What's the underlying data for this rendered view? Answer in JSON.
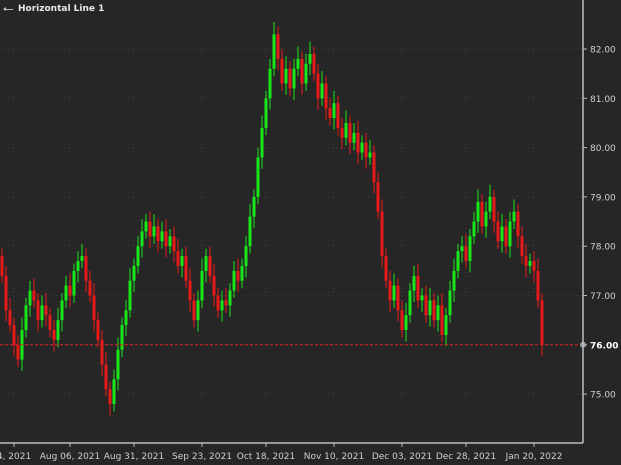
{
  "legend": {
    "label": "Horizontal Line 1",
    "icon": "horizontal-line-icon"
  },
  "colors": {
    "up": "#19e619",
    "down": "#e61919",
    "background": "#262626",
    "hline": "#e02020",
    "axis": "#bdbdbd"
  },
  "chart_data": {
    "type": "candlestick",
    "title": "",
    "xlabel": "",
    "ylabel": "",
    "ylim": [
      74.0,
      83.0
    ],
    "grid": true,
    "first_open": 77.8,
    "closes": [
      77.4,
      76.7,
      76.4,
      76.0,
      75.7,
      76.3,
      76.8,
      77.1,
      76.9,
      76.5,
      76.8,
      76.6,
      76.3,
      76.1,
      76.5,
      76.9,
      77.2,
      77.0,
      77.5,
      77.7,
      77.8,
      77.3,
      77.0,
      76.5,
      76.1,
      75.6,
      75.1,
      74.8,
      75.3,
      75.9,
      76.4,
      76.7,
      77.3,
      77.6,
      78.0,
      78.3,
      78.5,
      78.2,
      78.4,
      78.1,
      78.3,
      78.0,
      78.2,
      77.9,
      77.6,
      77.8,
      77.3,
      76.9,
      76.5,
      76.9,
      77.5,
      77.8,
      77.4,
      77.0,
      76.7,
      76.9,
      76.8,
      77.1,
      77.5,
      77.3,
      77.6,
      78.0,
      78.6,
      79.0,
      79.8,
      80.4,
      81.0,
      81.6,
      82.3,
      81.8,
      81.3,
      81.6,
      81.2,
      81.6,
      81.8,
      81.3,
      81.7,
      81.9,
      81.5,
      81.0,
      81.3,
      80.8,
      80.6,
      80.9,
      80.4,
      80.2,
      80.5,
      80.1,
      80.3,
      79.9,
      80.1,
      79.8,
      79.9,
      79.3,
      78.7,
      77.8,
      77.3,
      76.9,
      77.2,
      76.7,
      76.3,
      76.6,
      77.1,
      77.4,
      76.9,
      77.0,
      76.6,
      76.9,
      76.5,
      76.8,
      76.2,
      76.6,
      77.1,
      77.5,
      77.9,
      78.0,
      77.7,
      78.2,
      78.5,
      78.9,
      78.4,
      78.7,
      79.0,
      78.5,
      78.1,
      78.4,
      78.0,
      78.5,
      78.7,
      78.2,
      77.8,
      77.6,
      77.7,
      77.5,
      76.9,
      76.0
    ],
    "y_ticks": [
      "75.00",
      "76.00",
      "77.00",
      "78.00",
      "79.00",
      "80.00",
      "81.00",
      "82.00"
    ],
    "y_tick_values": [
      75,
      76,
      77,
      78,
      79,
      80,
      81,
      82
    ],
    "x_ticks": [
      {
        "label": "4, 2021",
        "index": 3
      },
      {
        "label": "Aug 06, 2021",
        "index": 17
      },
      {
        "label": "Aug 31, 2021",
        "index": 33
      },
      {
        "label": "Sep 23, 2021",
        "index": 50
      },
      {
        "label": "Oct 18, 2021",
        "index": 66
      },
      {
        "label": "Nov 10, 2021",
        "index": 83
      },
      {
        "label": "Dec 03, 2021",
        "index": 100
      },
      {
        "label": "Dec 28, 2021",
        "index": 116
      },
      {
        "label": "Jan 20, 2022",
        "index": 133
      }
    ],
    "horizontal_line": {
      "value": 76.0,
      "label": "76.00",
      "name": "Horizontal Line 1"
    }
  }
}
